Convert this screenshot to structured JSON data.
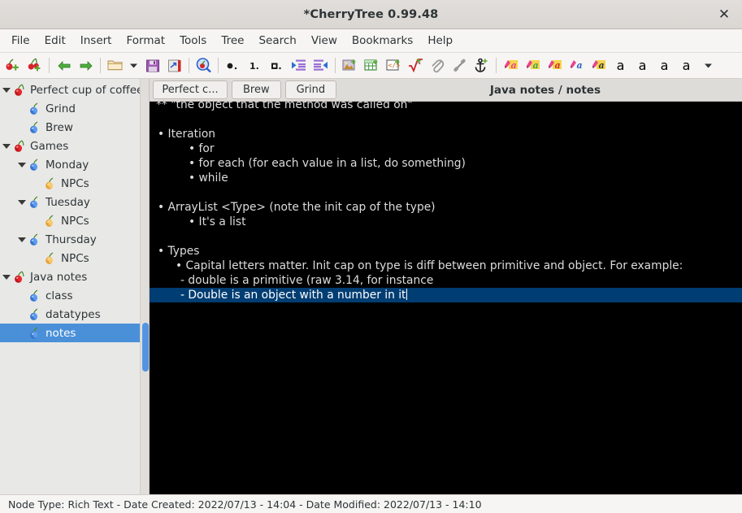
{
  "window": {
    "title": "*CherryTree 0.99.48",
    "close_label": "✕"
  },
  "menubar": {
    "items": [
      {
        "label": "File",
        "name": "menu-file"
      },
      {
        "label": "Edit",
        "name": "menu-edit"
      },
      {
        "label": "Insert",
        "name": "menu-insert"
      },
      {
        "label": "Format",
        "name": "menu-format"
      },
      {
        "label": "Tools",
        "name": "menu-tools"
      },
      {
        "label": "Tree",
        "name": "menu-tree"
      },
      {
        "label": "Search",
        "name": "menu-search"
      },
      {
        "label": "View",
        "name": "menu-view"
      },
      {
        "label": "Bookmarks",
        "name": "menu-bookmarks"
      },
      {
        "label": "Help",
        "name": "menu-help"
      }
    ]
  },
  "toolbar": {
    "items": [
      {
        "icon": "new-node-icon",
        "kind": "cherry-plus"
      },
      {
        "icon": "new-subnode-icon",
        "kind": "cherry-branch-plus"
      },
      {
        "icon": "separator",
        "kind": "sep"
      },
      {
        "icon": "go-back-icon",
        "kind": "arrow-left"
      },
      {
        "icon": "go-forward-icon",
        "kind": "arrow-right"
      },
      {
        "icon": "separator",
        "kind": "sep"
      },
      {
        "icon": "open-file-icon",
        "kind": "folder"
      },
      {
        "icon": "chevron-down-icon",
        "kind": "caret",
        "narrow": true
      },
      {
        "icon": "save-icon",
        "kind": "floppy"
      },
      {
        "icon": "save-as-icon",
        "kind": "saveas"
      },
      {
        "icon": "separator",
        "kind": "sep"
      },
      {
        "icon": "find-icon",
        "kind": "magnifier-cherry"
      },
      {
        "icon": "separator",
        "kind": "sep"
      },
      {
        "icon": "bulleted-list-icon",
        "kind": "bullet-list"
      },
      {
        "icon": "numbered-list-icon",
        "kind": "num-list"
      },
      {
        "icon": "todo-list-icon",
        "kind": "todo-list"
      },
      {
        "icon": "indent-increase-icon",
        "kind": "indent-in"
      },
      {
        "icon": "indent-decrease-icon",
        "kind": "indent-out"
      },
      {
        "icon": "separator",
        "kind": "sep"
      },
      {
        "icon": "insert-image-icon",
        "kind": "image"
      },
      {
        "icon": "insert-table-icon",
        "kind": "table"
      },
      {
        "icon": "insert-codebox-icon",
        "kind": "codebox"
      },
      {
        "icon": "insert-latex-icon",
        "kind": "latex"
      },
      {
        "icon": "attach-file-icon",
        "kind": "paperclip"
      },
      {
        "icon": "insert-link-icon",
        "kind": "link"
      },
      {
        "icon": "insert-anchor-icon",
        "kind": "anchor"
      },
      {
        "icon": "separator",
        "kind": "sep"
      },
      {
        "icon": "foreground-color-icon",
        "kind": "ink-a",
        "ink": "#e9438b",
        "letter": "#e9438b",
        "bg": "#f6d44a"
      },
      {
        "icon": "background-color-icon",
        "kind": "ink-a",
        "ink": "#e9438b",
        "letter": "#3fa34d",
        "bg": "#f6d44a"
      },
      {
        "icon": "remove-color-icon",
        "kind": "ink-a",
        "ink": "#e9438b",
        "letter": "#cc2a2a",
        "bg": "#f6d44a"
      },
      {
        "icon": "text-color-icon",
        "kind": "ink-a",
        "ink": "#e9438b",
        "letter": "#2a5fcc",
        "bg": "transparent"
      },
      {
        "icon": "highlight-color-icon",
        "kind": "ink-a",
        "ink": "#e9438b",
        "letter": "#2e3436",
        "bg": "#f6d44a"
      },
      {
        "icon": "bold-icon",
        "kind": "glyph",
        "glyph": "a",
        "style": "bold"
      },
      {
        "icon": "italic-icon",
        "kind": "glyph",
        "glyph": "a",
        "style": "italic"
      },
      {
        "icon": "underline-icon",
        "kind": "glyph",
        "glyph": "a",
        "style": "underline"
      },
      {
        "icon": "strikethrough-icon",
        "kind": "glyph",
        "glyph": "a",
        "style": "strike"
      },
      {
        "icon": "toolbar-overflow-icon",
        "kind": "caret"
      }
    ]
  },
  "sidebar": {
    "tree": [
      {
        "label": "Perfect cup of coffee",
        "depth": 0,
        "twisty": "expanded",
        "cherry": "red",
        "selected": false,
        "name": "tree-node-perfect-cup-of-coffee"
      },
      {
        "label": "Grind",
        "depth": 1,
        "twisty": "none",
        "cherry": "blue",
        "selected": false,
        "name": "tree-node-grind"
      },
      {
        "label": "Brew",
        "depth": 1,
        "twisty": "none",
        "cherry": "blue",
        "selected": false,
        "name": "tree-node-brew"
      },
      {
        "label": "Games",
        "depth": 0,
        "twisty": "expanded",
        "cherry": "red",
        "selected": false,
        "name": "tree-node-games"
      },
      {
        "label": "Monday",
        "depth": 1,
        "twisty": "expanded",
        "cherry": "blue",
        "selected": false,
        "name": "tree-node-monday"
      },
      {
        "label": "NPCs",
        "depth": 2,
        "twisty": "none",
        "cherry": "orange",
        "selected": false,
        "name": "tree-node-monday-npcs"
      },
      {
        "label": "Tuesday",
        "depth": 1,
        "twisty": "expanded",
        "cherry": "blue",
        "selected": false,
        "name": "tree-node-tuesday"
      },
      {
        "label": "NPCs",
        "depth": 2,
        "twisty": "none",
        "cherry": "orange",
        "selected": false,
        "name": "tree-node-tuesday-npcs"
      },
      {
        "label": "Thursday",
        "depth": 1,
        "twisty": "expanded",
        "cherry": "blue",
        "selected": false,
        "name": "tree-node-thursday"
      },
      {
        "label": "NPCs",
        "depth": 2,
        "twisty": "none",
        "cherry": "orange",
        "selected": false,
        "name": "tree-node-thursday-npcs"
      },
      {
        "label": "Java notes",
        "depth": 0,
        "twisty": "expanded",
        "cherry": "red",
        "selected": false,
        "name": "tree-node-java-notes"
      },
      {
        "label": "class",
        "depth": 1,
        "twisty": "none",
        "cherry": "blue",
        "selected": false,
        "name": "tree-node-class"
      },
      {
        "label": "datatypes",
        "depth": 1,
        "twisty": "none",
        "cherry": "blue",
        "selected": false,
        "name": "tree-node-datatypes"
      },
      {
        "label": "notes",
        "depth": 1,
        "twisty": "none",
        "cherry": "blue",
        "selected": true,
        "name": "tree-node-notes"
      }
    ]
  },
  "tabbar": {
    "tabs": [
      {
        "label": "Perfect c...",
        "name": "tab-perfect-cup"
      },
      {
        "label": "Brew",
        "name": "tab-brew"
      },
      {
        "label": "Grind",
        "name": "tab-grind"
      }
    ],
    "breadcrumb": "Java notes / notes"
  },
  "editor": {
    "lines": [
      {
        "text": "** \"the object that the method was called on\"",
        "style": "clip",
        "selected": false
      },
      {
        "text": "",
        "style": "blank",
        "selected": false
      },
      {
        "text": "• Iteration",
        "style": "l1",
        "selected": false
      },
      {
        "text": "• for",
        "style": "l2",
        "selected": false
      },
      {
        "text": "• for each (for each value in a list, do something)",
        "style": "l2",
        "selected": false
      },
      {
        "text": "• while",
        "style": "l2",
        "selected": false
      },
      {
        "text": "",
        "style": "blank",
        "selected": false
      },
      {
        "text": "• ArrayList <Type> (note the init cap of the type)",
        "style": "l1",
        "selected": false
      },
      {
        "text": "• It's a list",
        "style": "l2",
        "selected": false
      },
      {
        "text": "",
        "style": "blank",
        "selected": false
      },
      {
        "text": "• Types",
        "style": "l1",
        "selected": false
      },
      {
        "text": "• Capital letters matter. Init cap on type is diff between primitive and object. For example:",
        "style": "l2w",
        "selected": false
      },
      {
        "text": "- double is a primitive (raw 3.14, for instance",
        "style": "dash",
        "selected": false
      },
      {
        "text": "- Double is an object with a number in it",
        "style": "dash",
        "selected": true
      }
    ]
  },
  "statusbar": {
    "text": "Node Type: Rich Text  -  Date Created: 2022/07/13 - 14:04  -  Date Modified: 2022/07/13 - 14:10"
  },
  "colors": {
    "titlebar_bg": "#dad6d2",
    "chrome_bg": "#f6f5f4",
    "sidebar_bg": "#e8e8e7",
    "sidebar_selection": "#4a90d9",
    "editor_bg": "#000000",
    "editor_fg": "#dcdcdc",
    "editor_selection": "#003d72",
    "cherry_red": "#c1181d",
    "cherry_blue": "#2a6fd4",
    "cherry_orange": "#f0a93b"
  }
}
